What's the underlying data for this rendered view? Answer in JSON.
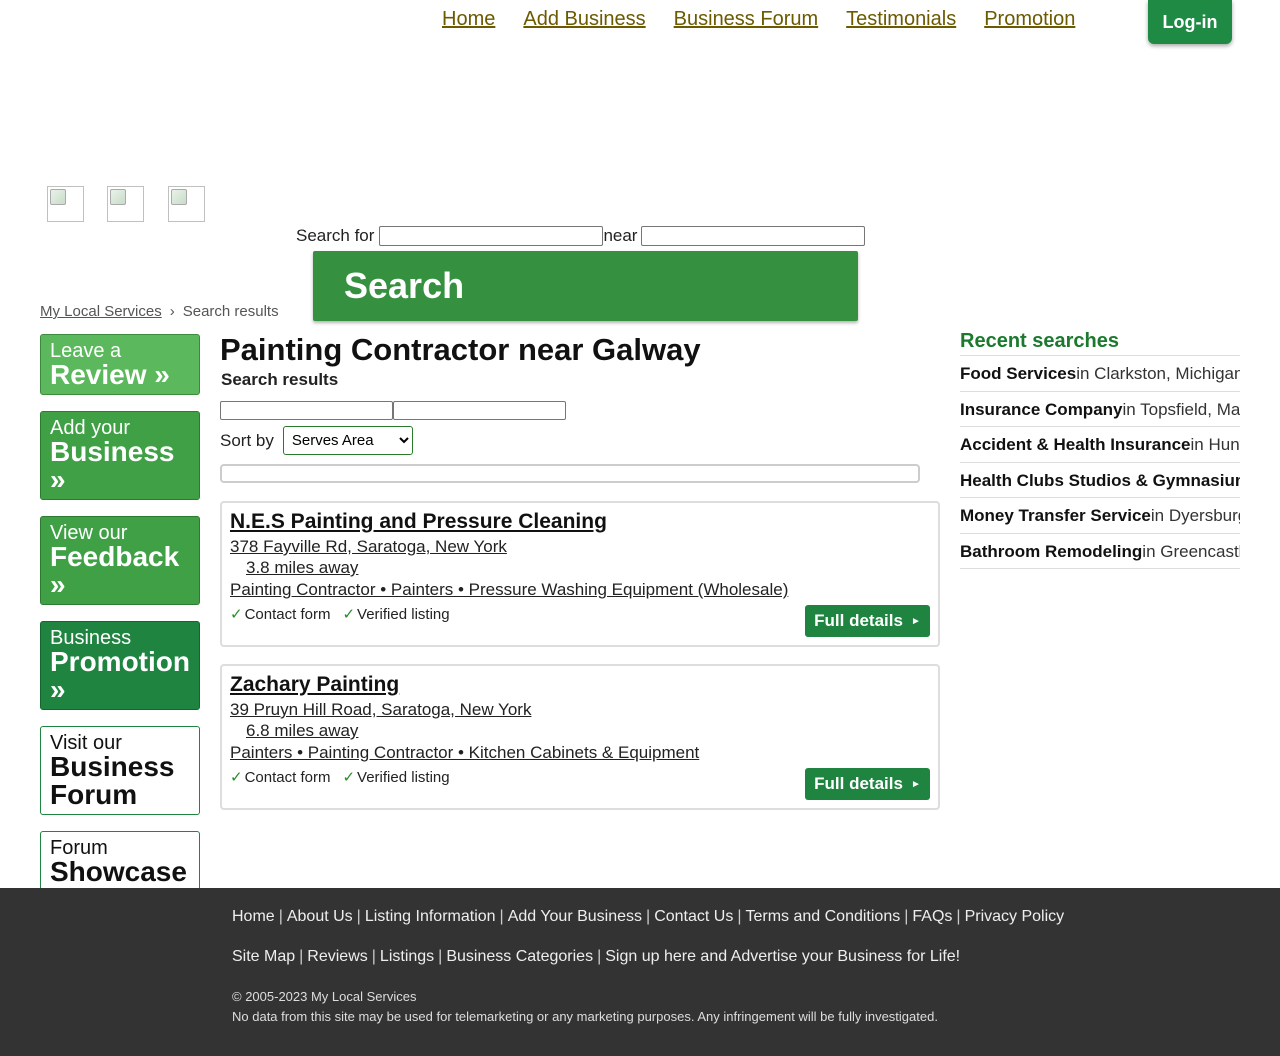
{
  "nav": {
    "items": [
      "Home",
      "Add Business",
      "Business Forum",
      "Testimonials",
      "Promotion"
    ],
    "login_label": "Log-in"
  },
  "search": {
    "search_for_label": "Search for",
    "near_label": "near",
    "button_label": "Search"
  },
  "breadcrumb": {
    "home": "My Local Services",
    "separator": "›",
    "current": "Search results"
  },
  "sidebar": {
    "items": [
      {
        "small": "Leave a",
        "big": "Review »"
      },
      {
        "small": "Add your",
        "big": "Business »"
      },
      {
        "small": "View our",
        "big": "Feedback »"
      },
      {
        "small": "Business",
        "big": "Promotion »"
      },
      {
        "small": "Visit our",
        "big": "Business Forum"
      },
      {
        "small": "Forum",
        "big": "Showcase"
      }
    ]
  },
  "main": {
    "title": "Painting Contractor near Galway",
    "subtitle": "Search results",
    "sort_label": "Sort by",
    "sort_selected": "Serves Area",
    "listings": [
      {
        "name": "N.E.S Painting and Pressure Cleaning",
        "address": "378 Fayville Rd, Saratoga, New York",
        "distance": "3.8 miles away",
        "categories": "Painting Contractor • Painters • Pressure Washing Equipment (Wholesale)",
        "feature1": "Contact form",
        "feature2": "Verified listing",
        "button": "Full details"
      },
      {
        "name": "Zachary Painting",
        "address": "39 Pruyn Hill Road, Saratoga, New York",
        "distance": "6.8 miles away",
        "categories": "Painters • Painting Contractor • Kitchen Cabinets & Equipment",
        "feature1": "Contact form",
        "feature2": "Verified listing",
        "button": "Full details"
      }
    ]
  },
  "recent": {
    "title": "Recent searches",
    "items": [
      {
        "what": "Food Services",
        "where": "in Clarkston, Michigan"
      },
      {
        "what": "Insurance Company",
        "where": "in Topsfield, Massachusetts"
      },
      {
        "what": "Accident & Health Insurance",
        "where": "in Huntington"
      },
      {
        "what": "Health Clubs Studios & Gymnasiums",
        "where": ""
      },
      {
        "what": "Money Transfer Service",
        "where": "in Dyersburg"
      },
      {
        "what": "Bathroom Remodeling",
        "where": "in Greencastle"
      }
    ]
  },
  "footer": {
    "links1": [
      "Home",
      "About Us",
      "Listing Information",
      "Add Your Business",
      "Contact Us",
      "Terms and Conditions",
      "FAQs",
      "Privacy Policy"
    ],
    "links2": [
      "Site Map",
      "Reviews",
      "Listings",
      "Business Categories",
      "Sign up here and Advertise your Business for Life!"
    ],
    "copyright": "© 2005-2023 My Local Services",
    "disclaimer": "No data from this site may be used for telemarketing or any marketing purposes. Any infringement will be fully investigated."
  },
  "colors": {
    "brand_green": "#1e8440",
    "nav_link": "#6b5a00",
    "footer_bg": "#333333"
  }
}
